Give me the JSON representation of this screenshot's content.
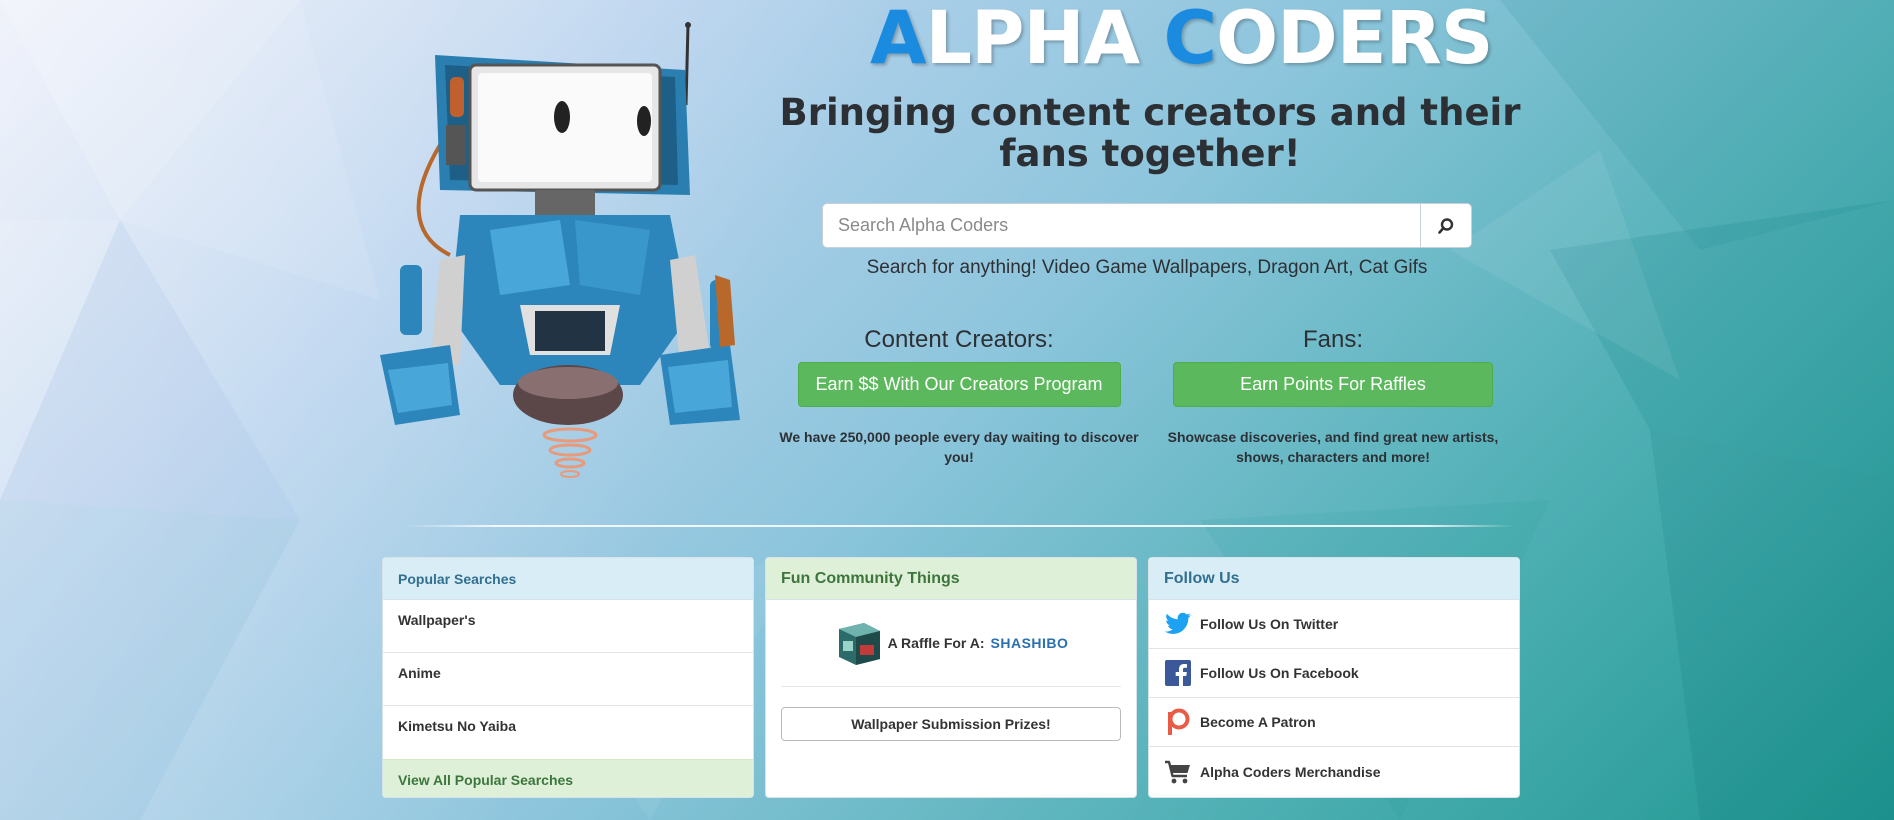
{
  "brand": {
    "logo_a": "A",
    "logo_lpha": "LPHA ",
    "logo_c": "C",
    "logo_oders": "ODERS",
    "accent_color": "#1b8be0"
  },
  "hero": {
    "tagline": "Bringing content creators and their fans together!"
  },
  "search": {
    "placeholder": "Search Alpha Coders",
    "value": "",
    "button_icon": "search-icon",
    "hint": "Search for anything! Video Game Wallpapers, Dragon Art, Cat Gifs"
  },
  "creators": {
    "heading": "Content Creators:",
    "button_label": "Earn $$ With Our Creators Program",
    "description": "We have 250,000 people every day waiting to discover you!"
  },
  "fans": {
    "heading": "Fans:",
    "button_label": "Earn Points For Raffles",
    "description": "Showcase discoveries, and find great new artists, shows, characters and more!"
  },
  "popular": {
    "title": "Popular Searches",
    "items": [
      {
        "label": "Wallpaper's"
      },
      {
        "label": "Anime"
      },
      {
        "label": "Kimetsu No Yaiba"
      }
    ],
    "footer": "View All Popular Searches"
  },
  "community": {
    "title": "Fun Community Things",
    "raffle_label": "A Raffle For A:",
    "raffle_item": "SHASHIBO",
    "prize_button": "Wallpaper Submission Prizes!"
  },
  "follow": {
    "title": "Follow Us",
    "items": [
      {
        "label": "Follow Us On Twitter",
        "icon": "twitter-icon",
        "color": "#1da1f2"
      },
      {
        "label": "Follow Us On Facebook",
        "icon": "facebook-icon",
        "color": "#3b5998"
      },
      {
        "label": "Become A Patron",
        "icon": "patreon-icon",
        "color": "#e85b46"
      },
      {
        "label": "Alpha Coders Merchandise",
        "icon": "shopping-cart-icon",
        "color": "#444444"
      }
    ]
  },
  "colors": {
    "green_button": "#5cb85c",
    "info_header": "#d9edf7",
    "success_header": "#dff0d8"
  }
}
